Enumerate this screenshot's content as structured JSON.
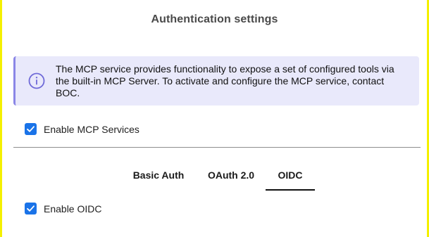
{
  "dialog": {
    "title": "Authentication settings"
  },
  "info": {
    "icon": "info-icon",
    "accent_color": "#8a86e6",
    "background_color": "#e9e9fb",
    "text": "The MCP service provides functionality to expose a set of configured tools via the built-in MCP Server. To activate and configure the MCP service, contact BOC."
  },
  "mcp_services": {
    "label": "Enable MCP Services",
    "checked": true
  },
  "tabs": [
    {
      "label": "Basic Auth",
      "active": false
    },
    {
      "label": "OAuth 2.0",
      "active": false
    },
    {
      "label": "OIDC",
      "active": true
    }
  ],
  "oidc": {
    "label": "Enable OIDC",
    "checked": true
  },
  "colors": {
    "checkbox": "#1a73e8",
    "side_border": "#f4f000"
  }
}
